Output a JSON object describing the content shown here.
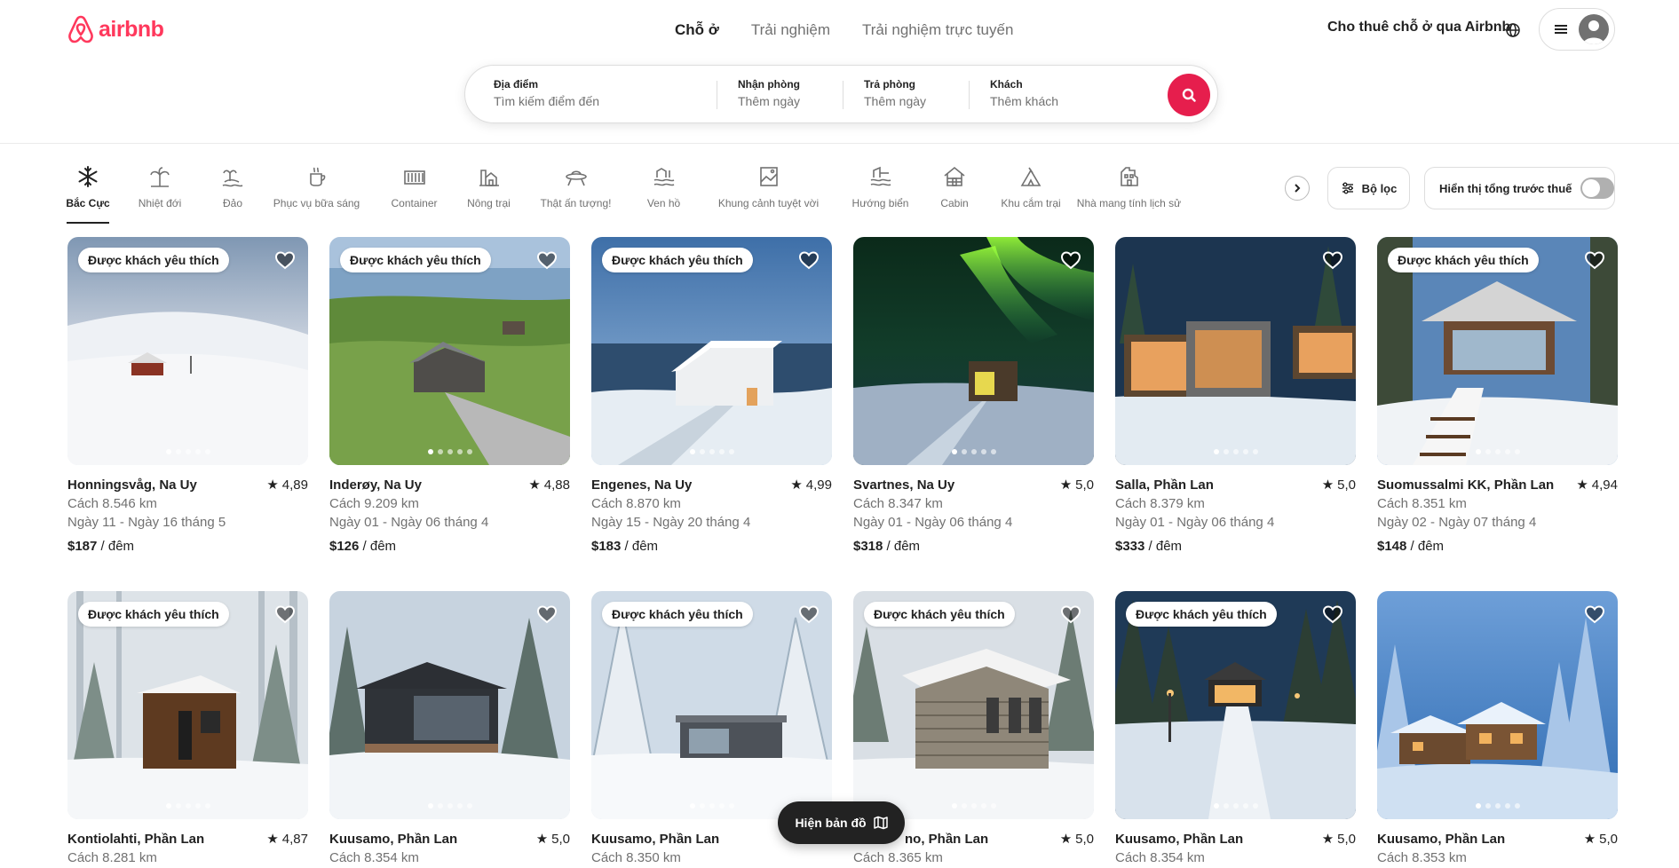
{
  "brand": {
    "name": "airbnb",
    "color": "#FF385C"
  },
  "nav": {
    "tabs": [
      "Chỗ ở",
      "Trải nghiệm",
      "Trải nghiệm trực tuyến"
    ],
    "active": 0
  },
  "header": {
    "host_link": "Cho thuê chỗ ở qua Airbnb",
    "globe_icon": "globe-icon",
    "menu_icon": "hamburger-icon",
    "avatar_icon": "user-avatar-icon"
  },
  "search": {
    "where": {
      "label": "Địa điểm",
      "placeholder": "Tìm kiếm điểm đến"
    },
    "checkin": {
      "label": "Nhận phòng",
      "placeholder": "Thêm ngày"
    },
    "checkout": {
      "label": "Trả phòng",
      "placeholder": "Thêm ngày"
    },
    "guests": {
      "label": "Khách",
      "placeholder": "Thêm khách"
    },
    "button_icon": "search-icon",
    "button_color": "#E61E4D"
  },
  "categories": [
    {
      "label": "Bắc Cực",
      "icon": "snowflake-icon"
    },
    {
      "label": "Nhiệt đới",
      "icon": "palm-tree-icon"
    },
    {
      "label": "Đảo",
      "icon": "island-icon"
    },
    {
      "label": "Phục vụ bữa sáng",
      "icon": "coffee-icon"
    },
    {
      "label": "Container",
      "icon": "container-icon"
    },
    {
      "label": "Nông trại",
      "icon": "farm-icon"
    },
    {
      "label": "Thật ấn tượng!",
      "icon": "ufo-icon"
    },
    {
      "label": "Ven hồ",
      "icon": "lake-icon"
    },
    {
      "label": "Khung cảnh tuyệt vời",
      "icon": "view-icon"
    },
    {
      "label": "Hướng biển",
      "icon": "beachfront-icon"
    },
    {
      "label": "Cabin",
      "icon": "cabin-icon"
    },
    {
      "label": "Khu cắm trại",
      "icon": "camping-icon"
    },
    {
      "label": "Nhà mang tính lịch sử",
      "icon": "historic-home-icon"
    }
  ],
  "active_category": 0,
  "filters": {
    "filter_label": "Bộ lọc",
    "tax_toggle_label": "Hiển thị tổng trước thuế",
    "tax_toggle_on": false
  },
  "listings": [
    {
      "location": "Honningsvåg, Na Uy",
      "rating": "4,89",
      "distance": "Cách 8.546 km",
      "dates": "Ngày 11 - Ngày 16 tháng 5",
      "price": "$187",
      "unit": " / đêm",
      "badge": "Được khách yêu thích"
    },
    {
      "location": "Inderøy, Na Uy",
      "rating": "4,88",
      "distance": "Cách 9.209 km",
      "dates": "Ngày 01 - Ngày 06 tháng 4",
      "price": "$126",
      "unit": " / đêm",
      "badge": "Được khách yêu thích"
    },
    {
      "location": "Engenes, Na Uy",
      "rating": "4,99",
      "distance": "Cách 8.870 km",
      "dates": "Ngày 15 - Ngày 20 tháng 4",
      "price": "$183",
      "unit": " / đêm",
      "badge": "Được khách yêu thích"
    },
    {
      "location": "Svartnes, Na Uy",
      "rating": "5,0",
      "distance": "Cách 8.347 km",
      "dates": "Ngày 01 - Ngày 06 tháng 4",
      "price": "$318",
      "unit": " / đêm",
      "badge": ""
    },
    {
      "location": "Salla, Phần Lan",
      "rating": "5,0",
      "distance": "Cách 8.379 km",
      "dates": "Ngày 01 - Ngày 06 tháng 4",
      "price": "$333",
      "unit": " / đêm",
      "badge": ""
    },
    {
      "location": "Suomussalmi KK, Phần Lan",
      "rating": "4,94",
      "distance": "Cách 8.351 km",
      "dates": "Ngày 02 - Ngày 07 tháng 4",
      "price": "$148",
      "unit": " / đêm",
      "badge": "Được khách yêu thích"
    },
    {
      "location": "Kontiolahti, Phần Lan",
      "rating": "4,87",
      "distance": "Cách 8.281 km",
      "badge": "Được khách yêu thích"
    },
    {
      "location": "Kuusamo, Phần Lan",
      "rating": "5,0",
      "distance": "Cách 8.354 km",
      "badge": ""
    },
    {
      "location": "Kuusamo, Phần Lan",
      "rating": "",
      "distance": "Cách 8.350 km",
      "badge": "Được khách yêu thích"
    },
    {
      "location": "no, Phần Lan",
      "rating": "5,0",
      "distance": "Cách 8.365 km",
      "badge": "Được khách yêu thích"
    },
    {
      "location": "Kuusamo, Phần Lan",
      "rating": "5,0",
      "distance": "Cách 8.354 km",
      "badge": "Được khách yêu thích"
    },
    {
      "location": "Kuusamo, Phần Lan",
      "rating": "5,0",
      "distance": "Cách 8.353 km",
      "badge": ""
    }
  ],
  "map_button": {
    "label": "Hiện bản đồ",
    "icon": "map-icon"
  }
}
